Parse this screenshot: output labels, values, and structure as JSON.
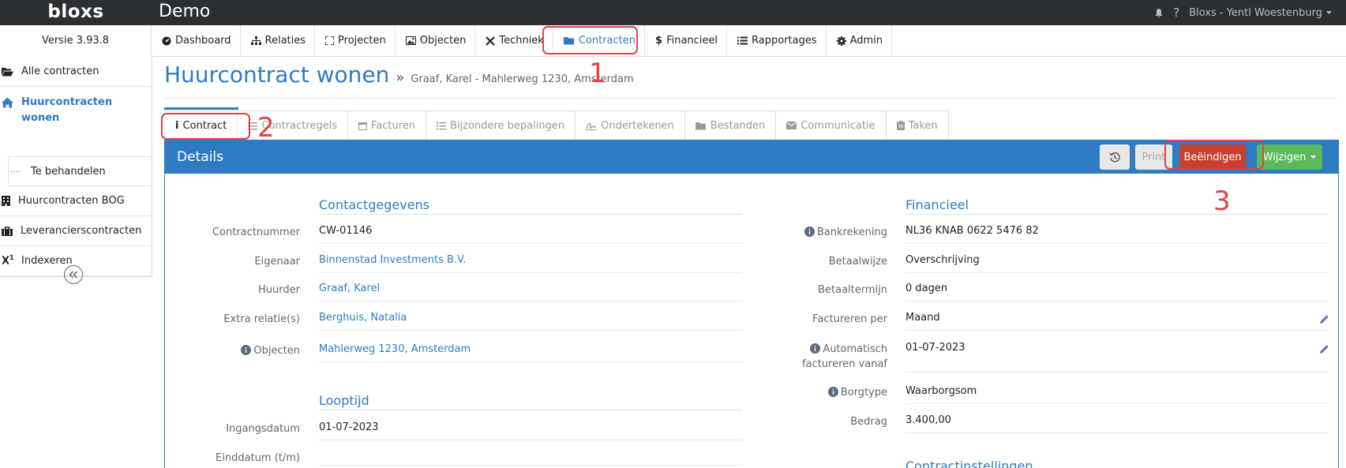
{
  "app": {
    "logo": "bloxs",
    "title": "Demo",
    "version": "Versie 3.93.8",
    "user": "Bloxs - Yentl Woestenburg"
  },
  "nav": [
    {
      "label": "Dashboard",
      "icon": "dashboard-icon"
    },
    {
      "label": "Relaties",
      "icon": "sitemap-icon"
    },
    {
      "label": "Projecten",
      "icon": "expand-icon"
    },
    {
      "label": "Objecten",
      "icon": "image-icon"
    },
    {
      "label": "Techniek",
      "icon": "wrench-icon"
    },
    {
      "label": "Contracten",
      "icon": "folder-icon"
    },
    {
      "label": "Financieel",
      "icon": "dollar-icon"
    },
    {
      "label": "Rapportages",
      "icon": "list-icon"
    },
    {
      "label": "Admin",
      "icon": "gear-icon"
    }
  ],
  "sidebar": {
    "items": [
      {
        "label": "Alle contracten",
        "icon": "folder-open-icon"
      },
      {
        "label": "Huurcontracten wonen",
        "icon": "home-icon"
      },
      {
        "label": "Te behandelen",
        "icon": ""
      },
      {
        "label": "Huurcontracten BOG",
        "icon": "building-icon"
      },
      {
        "label": "Leverancierscontracten",
        "icon": "briefcase-icon"
      },
      {
        "label": "Indexeren",
        "icon": "superscript-icon"
      }
    ]
  },
  "page": {
    "title": "Huurcontract wonen",
    "breadcrumb": "Graaf, Karel - Mahlerweg 1230, Amsterdam"
  },
  "tabs": [
    {
      "label": "Contract",
      "icon": "info-icon"
    },
    {
      "label": "Contractregels",
      "icon": "list-ol-icon"
    },
    {
      "label": "Facturen",
      "icon": "calendar-icon"
    },
    {
      "label": "Bijzondere bepalingen",
      "icon": "list-ol-icon"
    },
    {
      "label": "Ondertekenen",
      "icon": "signature-icon"
    },
    {
      "label": "Bestanden",
      "icon": "folder-icon"
    },
    {
      "label": "Communicatie",
      "icon": "envelope-icon"
    },
    {
      "label": "Taken",
      "icon": "clipboard-icon"
    }
  ],
  "panel": {
    "title": "Details",
    "buttons": {
      "print": "Print",
      "end": "Beëindigen",
      "edit": "Wijzigen"
    }
  },
  "contact": {
    "title": "Contactgegevens",
    "rows": [
      {
        "label": "Contractnummer",
        "value": "CW-01146"
      },
      {
        "label": "Eigenaar",
        "value": "Binnenstad Investments B.V."
      },
      {
        "label": "Huurder",
        "value": "Graaf, Karel"
      },
      {
        "label": "Extra relatie(s)",
        "value": "Berghuis, Natalia"
      },
      {
        "label": "Objecten",
        "value": "Mahlerweg 1230, Amsterdam"
      }
    ]
  },
  "looptijd": {
    "title": "Looptijd",
    "rows": [
      {
        "label": "Ingangsdatum",
        "value": "01-07-2023"
      },
      {
        "label": "Einddatum (t/m)",
        "value": ""
      }
    ]
  },
  "financieel": {
    "title": "Financieel",
    "rows": [
      {
        "label": "Bankrekening",
        "value": "NL36 KNAB 0622 5476 82"
      },
      {
        "label": "Betaalwijze",
        "value": "Overschrijving"
      },
      {
        "label": "Betaaltermijn",
        "value": "0 dagen"
      },
      {
        "label": "Factureren per",
        "value": "Maand"
      },
      {
        "label": "Automatisch factureren vanaf",
        "value": "01-07-2023"
      },
      {
        "label": "Borgtype",
        "value": "Waarborgsom"
      },
      {
        "label": "Bedrag",
        "value": "3.400,00"
      }
    ]
  },
  "contractinstellingen": {
    "title": "Contractinstellingen"
  },
  "annotations": [
    "1",
    "2",
    "3"
  ],
  "colors": {
    "accent": "#2e7bc4",
    "danger": "#c7402f",
    "success": "#5cb85c",
    "annotation": "#e04343",
    "topbar": "#2b2f33"
  }
}
